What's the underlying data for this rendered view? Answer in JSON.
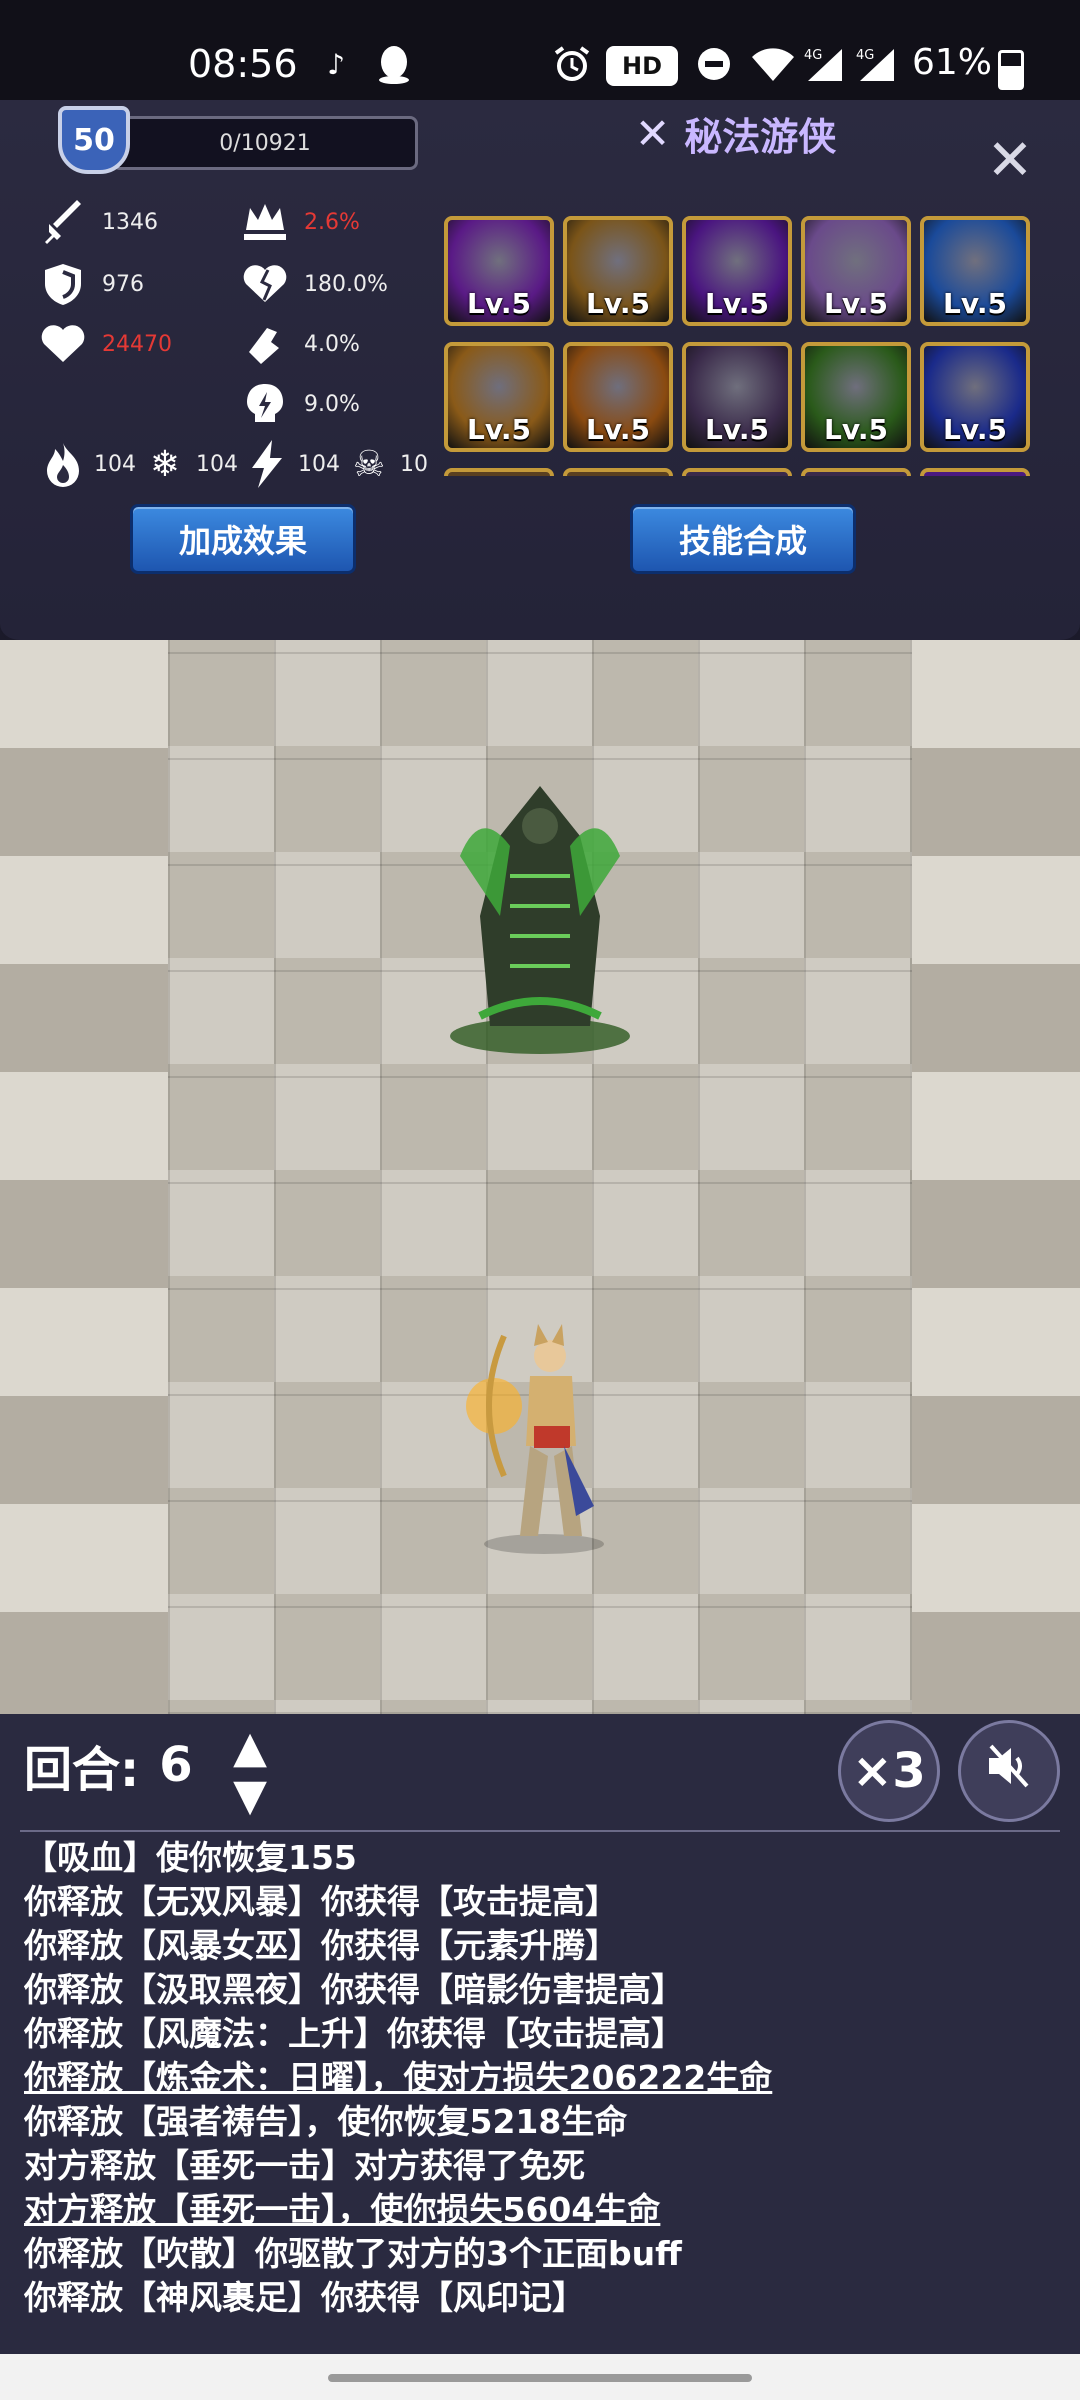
{
  "status_bar": {
    "time": "08:56",
    "hd_label": "HD",
    "battery": "61%"
  },
  "panel": {
    "level": "50",
    "xp": "0/10921",
    "class_name": "秘法游侠",
    "close_symbol": "✕",
    "stats": {
      "attack": "1346",
      "crit": "2.6%",
      "defense": "976",
      "crit_damage": "180.0%",
      "hp": "24470",
      "hit": "4.0%",
      "dodge": "9.0%",
      "fire": "104",
      "ice": "104",
      "lightning": "104",
      "poison": "10"
    },
    "skills": [
      {
        "level": "Lv.5",
        "color": "#5a1a86"
      },
      {
        "level": "Lv.5",
        "color": "#7a5418"
      },
      {
        "level": "Lv.5",
        "color": "#4a1580"
      },
      {
        "level": "Lv.5",
        "color": "#6a4a8a"
      },
      {
        "level": "Lv.5",
        "color": "#1a4a9a"
      },
      {
        "level": "Lv.5",
        "color": "#8a5a18"
      },
      {
        "level": "Lv.5",
        "color": "#8a4a10"
      },
      {
        "level": "Lv.5",
        "color": "#3a2a4a"
      },
      {
        "level": "Lv.5",
        "color": "#2a5a1a"
      },
      {
        "level": "Lv.5",
        "color": "#1a2a8a"
      }
    ],
    "buttons": {
      "bonus": "加成效果",
      "synthesis": "技能合成"
    }
  },
  "battle": {
    "round_label": "回合:",
    "round_value": "6",
    "speed": "×3"
  },
  "log": [
    {
      "text": "【吸血】使你恢复155",
      "underline": false
    },
    {
      "text": "你释放【无双风暴】你获得【攻击提高】",
      "underline": false
    },
    {
      "text": "你释放【风暴女巫】你获得【元素升腾】",
      "underline": false
    },
    {
      "text": "你释放【汲取黑夜】你获得【暗影伤害提高】",
      "underline": false
    },
    {
      "text": "你释放【风魔法：上升】你获得【攻击提高】",
      "underline": false
    },
    {
      "text": "你释放【炼金术：日曜】，使对方损失206222生命",
      "underline": true
    },
    {
      "text": "你释放【强者祷告】，使你恢复5218生命",
      "underline": false
    },
    {
      "text": "对方释放【垂死一击】对方获得了免死",
      "underline": false
    },
    {
      "text": "对方释放【垂死一击】，使你损失5604生命",
      "underline": true
    },
    {
      "text": "你释放【吹散】你驱散了对方的3个正面buff",
      "underline": false
    },
    {
      "text": "你释放【神风裹足】你获得【风印记】",
      "underline": false
    }
  ]
}
